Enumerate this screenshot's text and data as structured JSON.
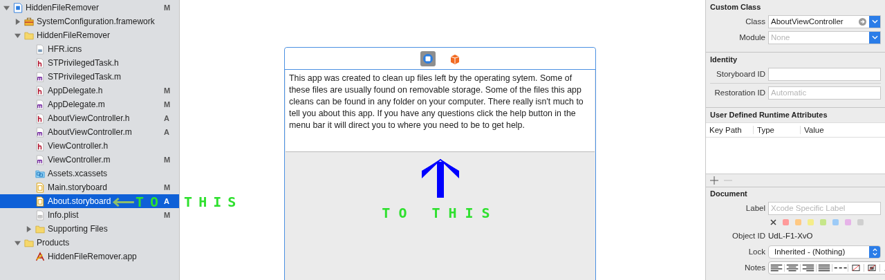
{
  "navigator": {
    "items": [
      {
        "name": "HiddenFileRemover",
        "kind": "project",
        "badge": "M",
        "expanded": true,
        "selected": false,
        "children": [
          {
            "name": "SystemConfiguration.framework",
            "kind": "toolbox",
            "expanded": false,
            "selected": false
          },
          {
            "name": "HiddenFileRemover",
            "kind": "folder",
            "expanded": true,
            "selected": false,
            "children": [
              {
                "name": "HFR.icns",
                "kind": "image",
                "selected": false
              },
              {
                "name": "STPrivilegedTask.h",
                "kind": "header",
                "selected": false
              },
              {
                "name": "STPrivilegedTask.m",
                "kind": "source",
                "selected": false
              },
              {
                "name": "AppDelegate.h",
                "kind": "header",
                "badge": "M",
                "selected": false
              },
              {
                "name": "AppDelegate.m",
                "kind": "source",
                "badge": "M",
                "selected": false
              },
              {
                "name": "AboutViewController.h",
                "kind": "header",
                "badge": "A",
                "selected": false
              },
              {
                "name": "AboutViewController.m",
                "kind": "source",
                "badge": "A",
                "selected": false
              },
              {
                "name": "ViewController.h",
                "kind": "header",
                "selected": false
              },
              {
                "name": "ViewController.m",
                "kind": "source",
                "badge": "M",
                "selected": false
              },
              {
                "name": "Assets.xcassets",
                "kind": "assets",
                "selected": false
              },
              {
                "name": "Main.storyboard",
                "kind": "storyboard",
                "badge": "M",
                "selected": false
              },
              {
                "name": "About.storyboard",
                "kind": "storyboard",
                "badge": "A",
                "selected": true
              },
              {
                "name": "Info.plist",
                "kind": "plist",
                "badge": "M",
                "selected": false
              },
              {
                "name": "Supporting Files",
                "kind": "folder",
                "expanded": false,
                "selected": false
              }
            ]
          },
          {
            "name": "Products",
            "kind": "folder",
            "expanded": true,
            "selected": false,
            "children": [
              {
                "name": "HiddenFileRemover.app",
                "kind": "app",
                "selected": false
              }
            ]
          }
        ]
      }
    ]
  },
  "annotations": {
    "row_word": "TO",
    "side_word": "THIS",
    "canvas_text": "TO THIS"
  },
  "scene": {
    "text": "This app was created to clean up files left by the operating sytem. Some of these files are usually found on removable storage. Some of the files this app cleans can be found in any folder on your computer. There really isn't much to tell you about this app. If you have any questions click the help button in the menu bar it will direct you to where you need to be to get help."
  },
  "inspector": {
    "custom_class": {
      "title": "Custom Class",
      "class_label": "Class",
      "class_value": "AboutViewController",
      "module_label": "Module",
      "module_placeholder": "None"
    },
    "identity": {
      "title": "Identity",
      "storyboard_id_label": "Storyboard ID",
      "restoration_id_label": "Restoration ID",
      "restoration_id_placeholder": "Automatic"
    },
    "runtime_attributes": {
      "title": "User Defined Runtime Attributes",
      "columns": [
        "Key Path",
        "Type",
        "Value"
      ]
    },
    "document": {
      "title": "Document",
      "label_label": "Label",
      "label_placeholder": "Xcode Specific Label",
      "colors": [
        {
          "color": "#ff9a9a"
        },
        {
          "color": "#ffc983"
        },
        {
          "color": "#f5ed8a"
        },
        {
          "color": "#c6e68a"
        },
        {
          "color": "#9dcbf7"
        },
        {
          "color": "#e6b3e8"
        },
        {
          "color": "#cfcfcf"
        }
      ],
      "object_id_label": "Object ID",
      "object_id": "UdL-F1-XvO",
      "lock_label": "Lock",
      "lock_value": "Inherited - (Nothing)",
      "notes_label": "Notes"
    }
  }
}
